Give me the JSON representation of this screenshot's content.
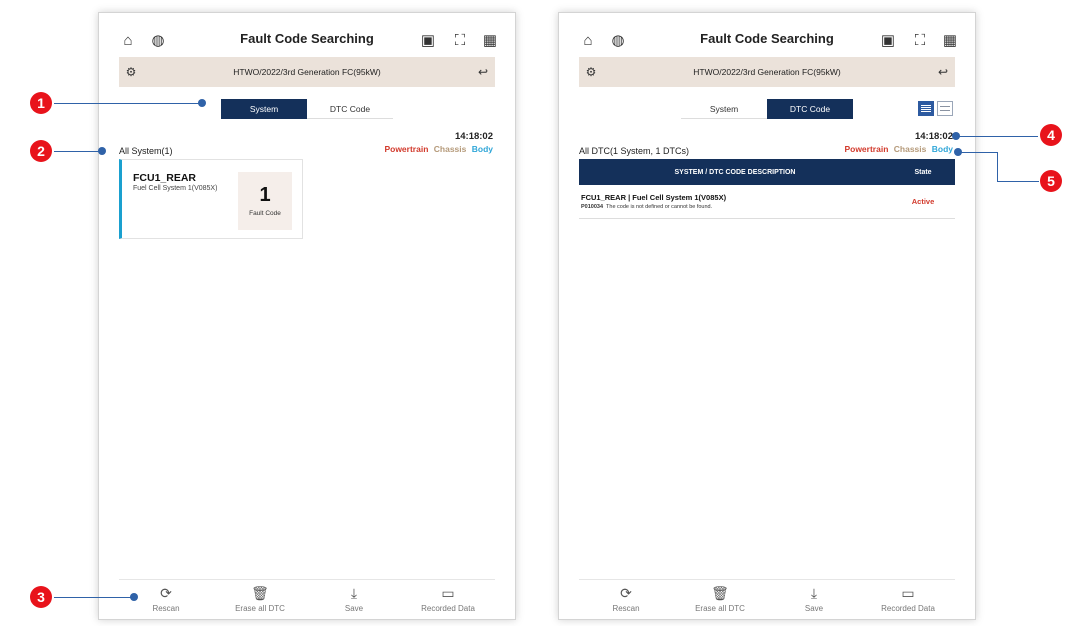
{
  "left": {
    "title": "Fault Code Searching",
    "vehicle": "HTWO/2022/3rd Generation FC(95kW)",
    "tabs": [
      "System",
      "DTC Code"
    ],
    "time": "14:18:02",
    "section_label": "All System(1)",
    "filters": [
      "Powertrain",
      "Chassis",
      "Body"
    ],
    "card": {
      "name": "FCU1_REAR",
      "sub": "Fuel Cell System 1(V085X)",
      "count": "1",
      "count_label": "Fault Code"
    },
    "bottom": [
      "Rescan",
      "Erase all DTC",
      "Save",
      "Recorded Data"
    ]
  },
  "right": {
    "title": "Fault Code Searching",
    "vehicle": "HTWO/2022/3rd Generation FC(95kW)",
    "tabs": [
      "System",
      "DTC Code"
    ],
    "time": "14:18:02",
    "section_label": "All DTC(1 System, 1 DTCs)",
    "filters": [
      "Powertrain",
      "Chassis",
      "Body"
    ],
    "table": {
      "head_desc": "SYSTEM / DTC CODE DESCRIPTION",
      "head_state": "State",
      "rows": [
        {
          "system": "FCU1_REAR | Fuel Cell System 1(V085X)",
          "code": "P010034",
          "desc": "The code is not defined or cannot be found.",
          "state": "Active"
        }
      ]
    },
    "bottom": [
      "Rescan",
      "Erase all DTC",
      "Save",
      "Recorded Data"
    ]
  },
  "callouts": [
    "1",
    "2",
    "3",
    "4",
    "5"
  ],
  "colors": {
    "navy": "#14305a",
    "powertrain": "#d23a2c",
    "chassis": "#b59a7a",
    "body": "#2fa6d8",
    "badge": "#e8131b",
    "callout_line": "#2f62a8",
    "card_accent": "#1aa0cf"
  }
}
